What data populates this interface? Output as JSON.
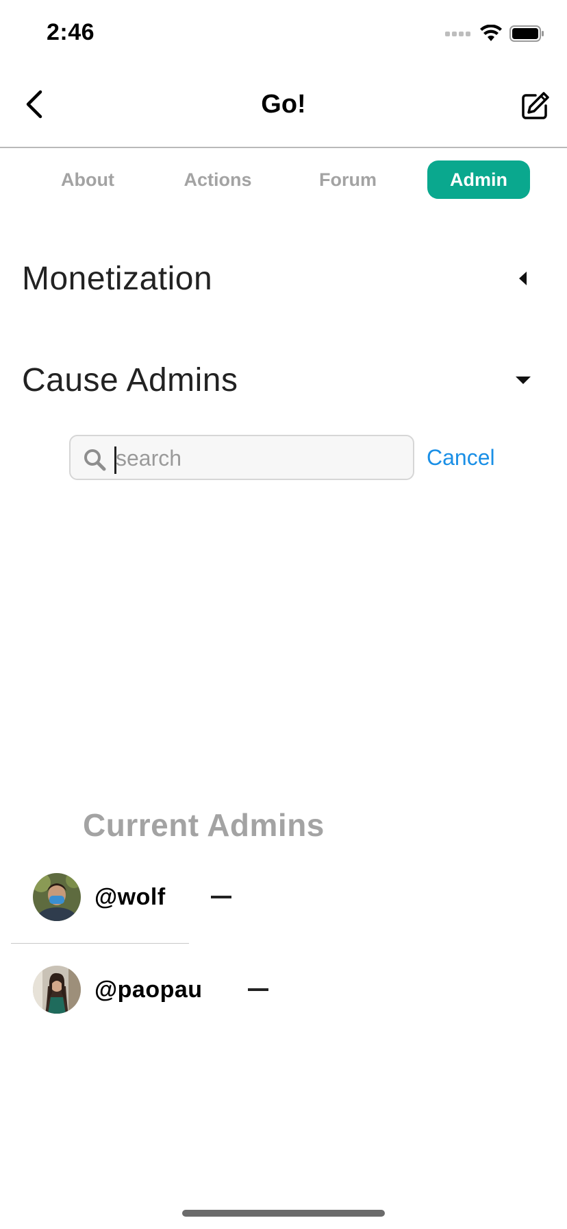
{
  "status_bar": {
    "time": "2:46",
    "icons": [
      "signal-dots-icon",
      "wifi-icon",
      "battery-icon"
    ]
  },
  "nav": {
    "title": "Go!",
    "back_icon": "chevron-left-icon",
    "edit_icon": "edit-icon"
  },
  "tabs": [
    {
      "label": "About",
      "active": false
    },
    {
      "label": "Actions",
      "active": false
    },
    {
      "label": "Forum",
      "active": false
    },
    {
      "label": "Admin",
      "active": true
    }
  ],
  "sections": {
    "monetization": {
      "title": "Monetization",
      "toggle_icon": "caret-left-icon",
      "expanded": false
    },
    "cause_admins": {
      "title": "Cause Admins",
      "toggle_icon": "caret-down-icon",
      "expanded": true
    }
  },
  "search": {
    "placeholder": "search",
    "value": "",
    "cancel_label": "Cancel"
  },
  "current_admins": {
    "title": "Current Admins",
    "admins": [
      {
        "handle": "@wolf",
        "remove_icon": "minus-icon"
      },
      {
        "handle": "@paopau",
        "remove_icon": "minus-icon"
      }
    ]
  },
  "colors": {
    "accent": "#0aa88e",
    "link": "#1a8fe6",
    "muted": "#a3a3a3"
  }
}
